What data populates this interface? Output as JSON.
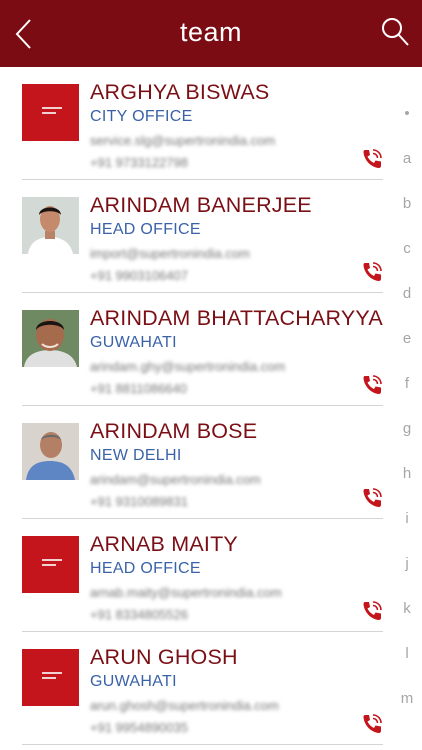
{
  "header": {
    "title": "team"
  },
  "contacts": [
    {
      "name": "ARGHYA BISWAS",
      "office": "CITY OFFICE",
      "email": "service.slg@supertronindia.com",
      "phone": "+91 9733122798",
      "avatar": "logo"
    },
    {
      "name": "ARINDAM BANERJEE",
      "office": "HEAD OFFICE",
      "email": "import@supertronindia.com",
      "phone": "+91 9903106407",
      "avatar": "photo"
    },
    {
      "name": "ARINDAM BHATTACHARYYA",
      "office": "GUWAHATI",
      "email": "arindam.ghy@supertronindia.com",
      "phone": "+91 8811086640",
      "avatar": "photo"
    },
    {
      "name": "ARINDAM BOSE",
      "office": "NEW DELHI",
      "email": "arindam@supertronindia.com",
      "phone": "+91 9310089831",
      "avatar": "photo"
    },
    {
      "name": "ARNAB MAITY",
      "office": "HEAD OFFICE",
      "email": "arnab.maity@supertronindia.com",
      "phone": "+91 8334805526",
      "avatar": "logo"
    },
    {
      "name": "ARUN GHOSH",
      "office": "GUWAHATI",
      "email": "arun.ghosh@supertronindia.com",
      "phone": "+91 9954890035",
      "avatar": "logo"
    }
  ],
  "alphabet": [
    "•",
    "a",
    "b",
    "c",
    "d",
    "e",
    "f",
    "g",
    "h",
    "i",
    "j",
    "k",
    "l",
    "m"
  ],
  "colors": {
    "header": "#7b0c14",
    "name": "#7a1016",
    "office": "#3a62a8",
    "logo_bg": "#c4151c"
  },
  "icons": {
    "back": "chevron-left-icon",
    "search": "search-icon",
    "call": "phone-icon"
  }
}
